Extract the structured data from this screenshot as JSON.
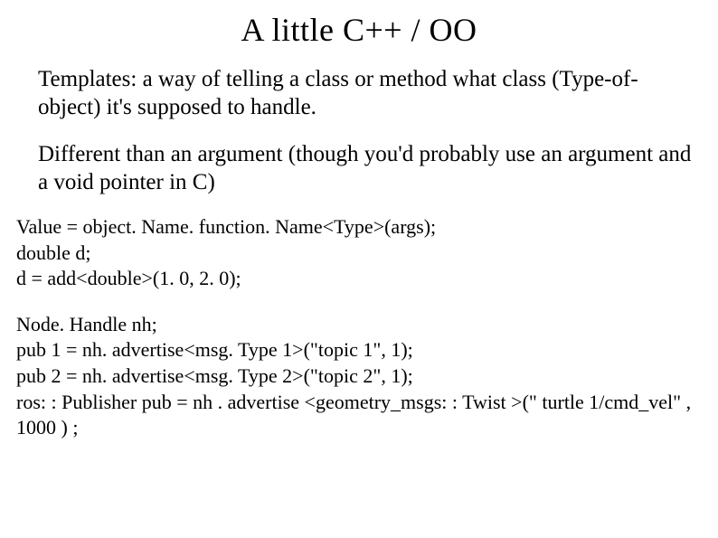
{
  "title": "A little C++ / OO",
  "para1": "Templates: a way of telling a class or method what class (Type-of-object) it's supposed to handle.",
  "para2": "Different than an argument (though you'd probably use an argument and a void pointer in C)",
  "code1": {
    "line1": "Value = object. Name. function. Name<Type>(args);",
    "line2": "double d;",
    "line3": "d = add<double>(1. 0, 2. 0);"
  },
  "code2": {
    "line1": "Node. Handle nh;",
    "line2": "pub 1 = nh. advertise<msg. Type 1>(\"topic 1\", 1);",
    "line3": "pub 2 = nh. advertise<msg. Type 2>(\"topic 2\",  1);",
    "line4": "ros: : Publisher pub = nh . advertise <geometry_msgs: : Twist >(\" turtle 1/cmd_vel\" , 1000 ) ;"
  }
}
